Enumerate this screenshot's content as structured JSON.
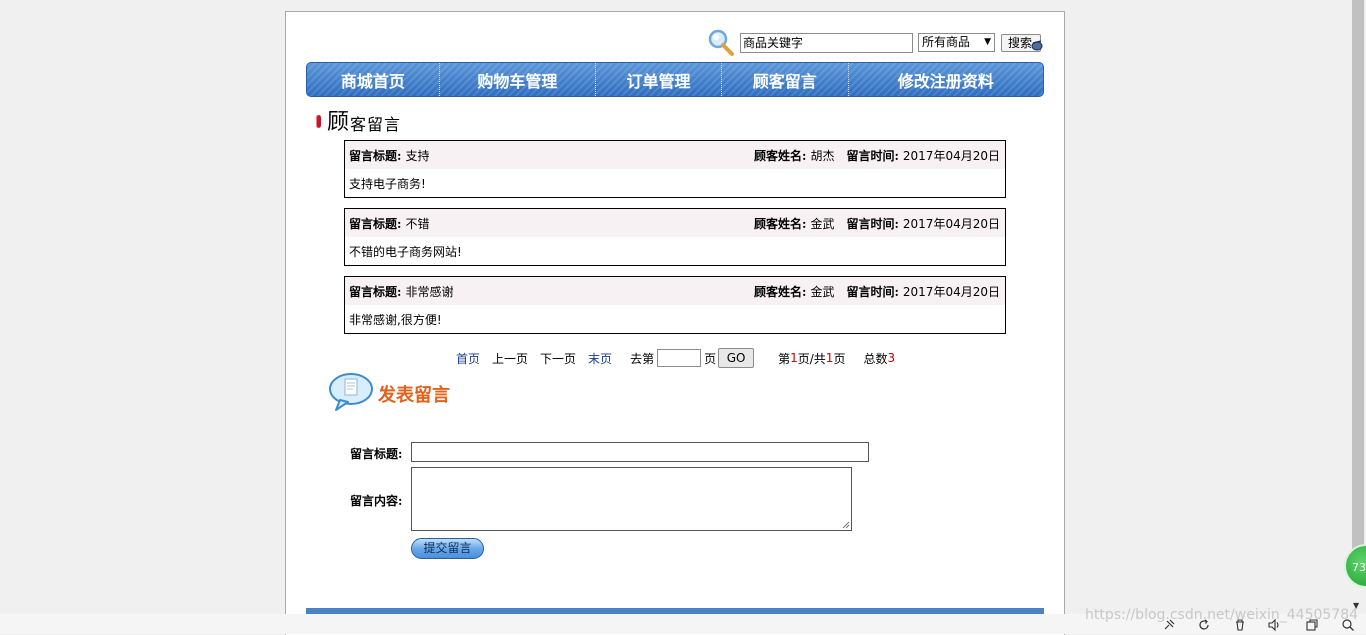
{
  "search": {
    "placeholder": "商品关键字",
    "category": "所有商品",
    "button_label": "搜索"
  },
  "nav": {
    "items": [
      {
        "label": "商城首页"
      },
      {
        "label": "购物车管理"
      },
      {
        "label": "订单管理"
      },
      {
        "label": "顾客留言"
      },
      {
        "label": "修改注册资料"
      }
    ]
  },
  "section": {
    "title_first": "顾",
    "title_rest": "客留言"
  },
  "labels": {
    "msg_title": "留言标题:",
    "customer_name": "顾客姓名:",
    "msg_time": "留言时间:"
  },
  "messages": [
    {
      "title": "支持",
      "name": "胡杰",
      "time": "2017年04月20日",
      "content": "支持电子商务!"
    },
    {
      "title": "不错",
      "name": "金武",
      "time": "2017年04月20日",
      "content": "不错的电子商务网站!"
    },
    {
      "title": "非常感谢",
      "name": "金武",
      "time": "2017年04月20日",
      "content": "非常感谢,很方便!"
    }
  ],
  "pagination": {
    "first": "首页",
    "prev": "上一页",
    "next": "下一页",
    "last": "末页",
    "goto_prefix": "去第",
    "goto_suffix": "页",
    "go_button": "GO",
    "page_prefix": "第",
    "current_page": "1",
    "page_mid": "页/共",
    "total_pages": "1",
    "page_suffix": "页",
    "total_prefix": "总数",
    "total": "3"
  },
  "post_form": {
    "heading": "发表留言",
    "title_label": "留言标题:",
    "content_label": "留言内容:",
    "title_value": "",
    "content_value": "",
    "submit_label": "提交留言"
  },
  "floating_badge": "73",
  "watermark": "https://blog.csdn.net/weixin_44505784",
  "colors": {
    "nav_blue": "#3a78c8",
    "accent_orange": "#e2621b",
    "page_total_red": "#cc0000",
    "link_blue": "#1a3c8f"
  }
}
